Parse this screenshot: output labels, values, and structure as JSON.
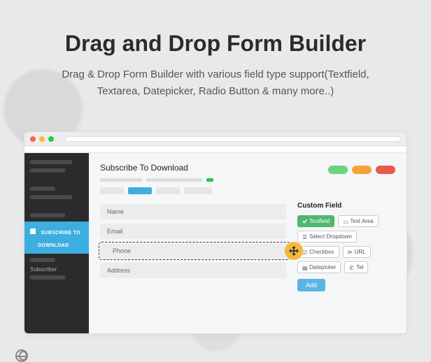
{
  "hero": {
    "title": "Drag and Drop Form Builder",
    "subtitle": "Drag & Drop Form Builder with various field type support(Textfield, Textarea, Datepicker, Radio Button & many more..)"
  },
  "sidebar": {
    "highlight_line1": "SUBSCRIBE TO",
    "highlight_line2": "DOWNLOAD",
    "subscriber_label": "Subscriber"
  },
  "form": {
    "title": "Subscribe To Download",
    "fields": {
      "name": "Name",
      "email": "Email",
      "phone": "Phone",
      "address": "Address"
    }
  },
  "custom_field": {
    "title": "Custom Field",
    "chips": {
      "textfield": "Textfield",
      "textarea": "Text Area",
      "select": "Select Dropdown",
      "checkbox": "Checkbox",
      "url": "URL",
      "datepicker": "Datepicker",
      "tel": "Tel"
    },
    "add": "Add"
  }
}
